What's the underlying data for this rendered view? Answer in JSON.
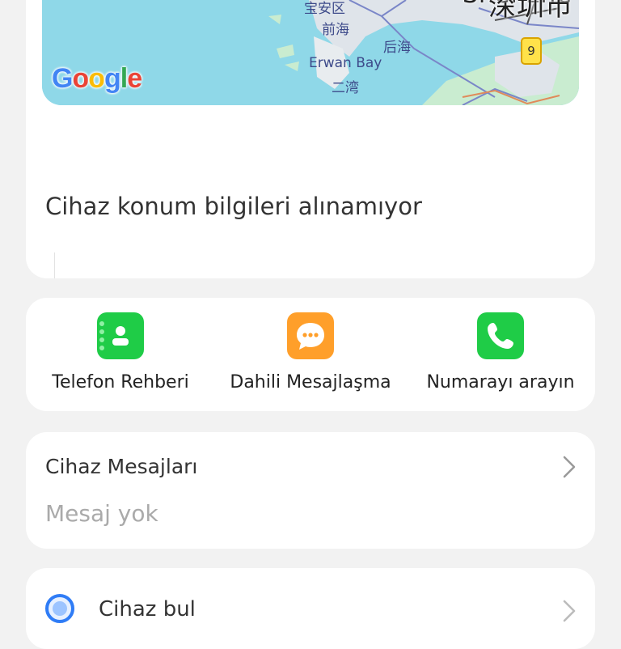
{
  "map": {
    "labels": {
      "baoan": "宝安区",
      "qianhai": "前海",
      "houhai": "后海",
      "erwan_en": "Erwan Bay",
      "erwan_zh": "二湾",
      "city_en": "Shenzhe",
      "city_zh": "深圳市",
      "route_number": "9"
    },
    "logo": {
      "g1": "G",
      "o1": "o",
      "o2": "o",
      "g2": "g",
      "l": "l",
      "e": "e"
    }
  },
  "location": {
    "status": "Cihaz konum bilgileri alınamıyor"
  },
  "actions": [
    {
      "label": "Telefon Rehberi",
      "icon": "contacts-book-icon",
      "color": "#1fcc47"
    },
    {
      "label": "Dahili Mesajlaşma",
      "icon": "chat-bubble-icon",
      "color": "#ff9f2a"
    },
    {
      "label": "Numarayı arayın",
      "icon": "phone-icon",
      "color": "#1fcc47"
    }
  ],
  "messages": {
    "title": "Cihaz Mesajları",
    "empty": "Mesaj yok"
  },
  "find_device": {
    "label": "Cihaz bul",
    "icon": "search-icon"
  },
  "colors": {
    "background": "#f2f2f2",
    "card": "#ffffff",
    "water": "#8fd8e8",
    "land": "#c9ecd0"
  }
}
